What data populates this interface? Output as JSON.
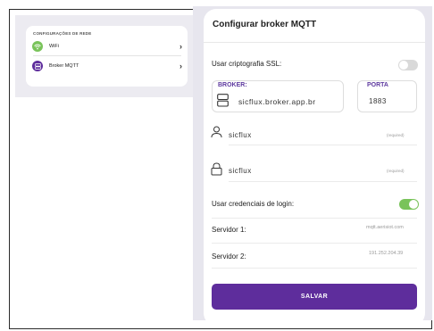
{
  "settings": {
    "section_title": "CONFIGURAÇÕES DE REDE",
    "items": [
      {
        "label": "WiFi",
        "icon": "wifi-icon",
        "color": "#79c35a"
      },
      {
        "label": "Broker MQTT",
        "icon": "server-icon",
        "color": "#5e2d9c"
      }
    ]
  },
  "mqtt": {
    "title": "Configurar broker MQTT",
    "ssl_label": "Usar criptografia SSL:",
    "ssl_enabled": false,
    "broker_label": "BROKER:",
    "broker_value": "sicflux.broker.app.br",
    "port_label": "PORTA",
    "port_value": "1883",
    "username": "sicflux",
    "username_hint": "(required)",
    "password": "sicflux",
    "password_hint": "(required)",
    "credentials_label": "Usar credenciais de login:",
    "credentials_enabled": true,
    "server1_label": "Servidor 1:",
    "server1_value": "mqtt.aerisiot.com",
    "server2_label": "Servidor 2:",
    "server2_value": "191.252.204.39",
    "save_label": "SALVAR"
  },
  "colors": {
    "accent": "#5e2d9c",
    "toggle_on": "#79c35a",
    "toggle_off": "#d9d9d9"
  }
}
